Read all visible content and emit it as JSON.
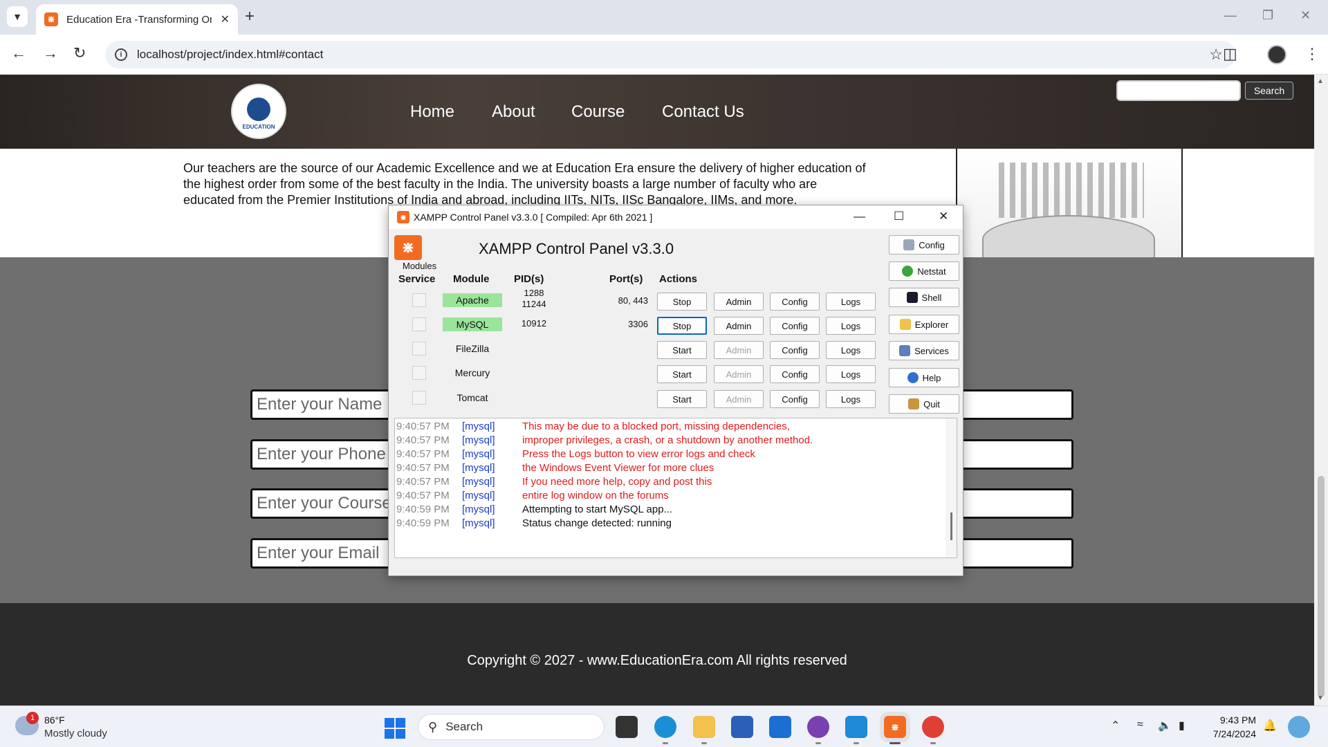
{
  "browser": {
    "tab_title": "Education Era -Transforming Or",
    "tab_favicon": "xampp-favicon",
    "url": "localhost/project/index.html#contact",
    "new_tab": "+",
    "tab_close": "✕"
  },
  "site": {
    "nav": [
      "Home",
      "About",
      "Course",
      "Contact Us"
    ],
    "search_button": "Search",
    "logo_text": "EDUCATION",
    "intro_lines": [
      "Our teachers are the source of our Academic Excellence and we at Education Era ensure the delivery of higher education of",
      "the highest order from some of the best faculty in the India. The university boasts a large number of faculty who are",
      "educated from the Premier Institutions of India and abroad, including IITs, NITs, IISc Bangalore, IIMs, and more."
    ],
    "form_placeholders": [
      "Enter your Name",
      "Enter your Phone",
      "Enter your Course",
      "Enter your Email"
    ],
    "footer_text": "Copyright © 2027 - www.EducationEra.com All rights reserved"
  },
  "xampp": {
    "window_title": "XAMPP Control Panel v3.3.0   [ Compiled: Apr 6th 2021 ]",
    "heading": "XAMPP Control Panel v3.3.0",
    "modules_label": "Modules",
    "columns": {
      "service": "Service",
      "module": "Module",
      "pid": "PID(s)",
      "port": "Port(s)",
      "actions": "Actions"
    },
    "rows": [
      {
        "module": "Apache",
        "running": true,
        "pid": [
          "1288",
          "11244"
        ],
        "ports": "80, 443",
        "start_stop": "Stop",
        "admin": "Admin",
        "admin_enabled": true,
        "config": "Config",
        "logs": "Logs"
      },
      {
        "module": "MySQL",
        "running": true,
        "pid": [
          "10912"
        ],
        "ports": "3306",
        "start_stop": "Stop",
        "admin": "Admin",
        "admin_enabled": true,
        "config": "Config",
        "logs": "Logs"
      },
      {
        "module": "FileZilla",
        "running": false,
        "pid": [],
        "ports": "",
        "start_stop": "Start",
        "admin": "Admin",
        "admin_enabled": false,
        "config": "Config",
        "logs": "Logs"
      },
      {
        "module": "Mercury",
        "running": false,
        "pid": [],
        "ports": "",
        "start_stop": "Start",
        "admin": "Admin",
        "admin_enabled": false,
        "config": "Config",
        "logs": "Logs"
      },
      {
        "module": "Tomcat",
        "running": false,
        "pid": [],
        "ports": "",
        "start_stop": "Start",
        "admin": "Admin",
        "admin_enabled": false,
        "config": "Config",
        "logs": "Logs"
      }
    ],
    "side_buttons": [
      {
        "label": "Config",
        "icon": "wrench-icon"
      },
      {
        "label": "Netstat",
        "icon": "globe-icon"
      },
      {
        "label": "Shell",
        "icon": "terminal-icon"
      },
      {
        "label": "Explorer",
        "icon": "folder-icon"
      },
      {
        "label": "Services",
        "icon": "services-icon"
      },
      {
        "label": "Help",
        "icon": "help-icon"
      },
      {
        "label": "Quit",
        "icon": "quit-icon"
      }
    ],
    "log": [
      {
        "time": "9:40:57 PM",
        "source": "[mysql]",
        "message": "This may be due to a blocked port, missing dependencies,",
        "error": true
      },
      {
        "time": "9:40:57 PM",
        "source": "[mysql]",
        "message": "improper privileges, a crash, or a shutdown by another method.",
        "error": true
      },
      {
        "time": "9:40:57 PM",
        "source": "[mysql]",
        "message": "Press the Logs button to view error logs and check",
        "error": true
      },
      {
        "time": "9:40:57 PM",
        "source": "[mysql]",
        "message": "the Windows Event Viewer for more clues",
        "error": true
      },
      {
        "time": "9:40:57 PM",
        "source": "[mysql]",
        "message": "If you need more help, copy and post this",
        "error": true
      },
      {
        "time": "9:40:57 PM",
        "source": "[mysql]",
        "message": "entire log window on the forums",
        "error": true
      },
      {
        "time": "9:40:59 PM",
        "source": "[mysql]",
        "message": "Attempting to start MySQL app...",
        "error": false
      },
      {
        "time": "9:40:59 PM",
        "source": "[mysql]",
        "message": "Status change detected: running",
        "error": false
      }
    ]
  },
  "taskbar": {
    "weather_temp": "86°F",
    "weather_desc": "Mostly cloudy",
    "weather_badge": "1",
    "search_label": "Search",
    "time": "9:43 PM",
    "date": "7/24/2024"
  },
  "colors": {
    "xampp_orange": "#f26b22",
    "running_green": "#9ae59a",
    "log_error_red": "#e01b1b",
    "log_source_blue": "#1a3cc8",
    "form_band_gray": "#6f6f6f",
    "footer_dark": "#2b2b2b"
  }
}
